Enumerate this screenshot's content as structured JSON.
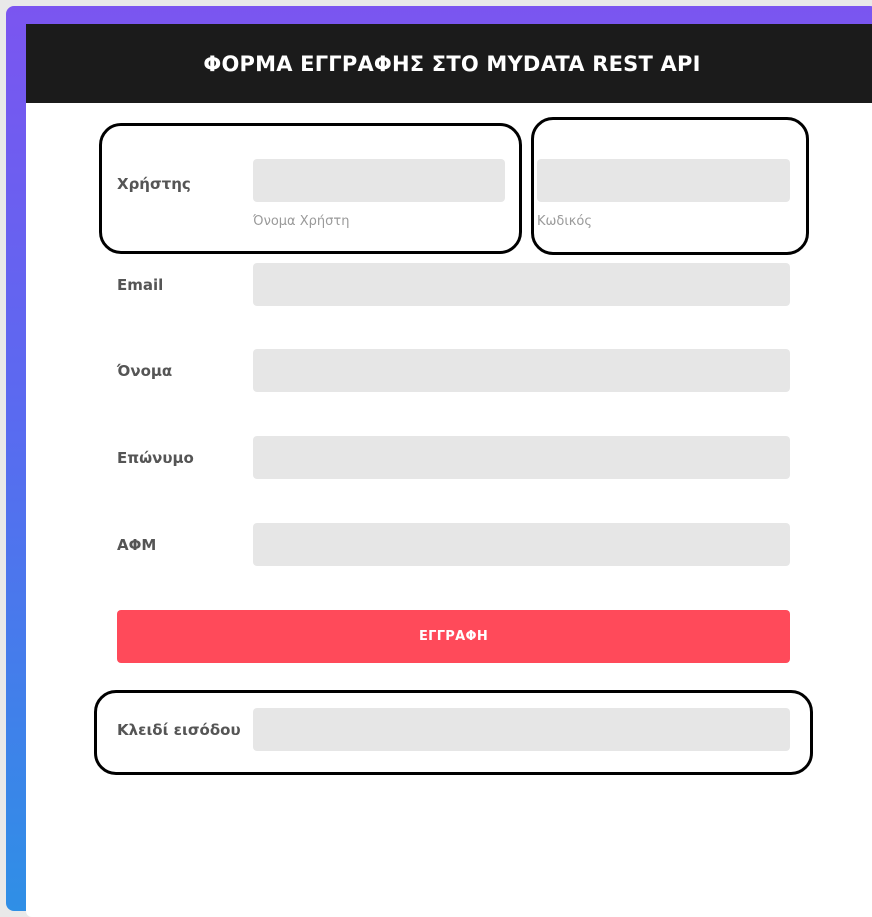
{
  "header": {
    "title": "ΦΟΡΜΑ ΕΓΓΡΑΦΗΣ ΣΤΟ MYDATA REST API"
  },
  "form": {
    "username": {
      "label": "Χρήστης",
      "value": "",
      "hint": "Όνομα Χρήστη"
    },
    "password": {
      "value": "",
      "hint": "Κωδικός"
    },
    "email": {
      "label": "Email",
      "value": ""
    },
    "first_name": {
      "label": "Όνομα",
      "value": ""
    },
    "last_name": {
      "label": "Επώνυμο",
      "value": ""
    },
    "afm": {
      "label": "ΑΦΜ",
      "value": ""
    },
    "submit_label": "ΕΓΓΡΑΦΗ",
    "access_key": {
      "label": "Κλειδί εισόδου",
      "value": ""
    }
  },
  "colors": {
    "header_bg": "#1b1b1b",
    "submit_bg": "#ff4a5a",
    "input_bg": "#e6e6e6",
    "frame_gradient_top": "#7b55f0",
    "frame_gradient_bottom": "#2f8fe6"
  }
}
